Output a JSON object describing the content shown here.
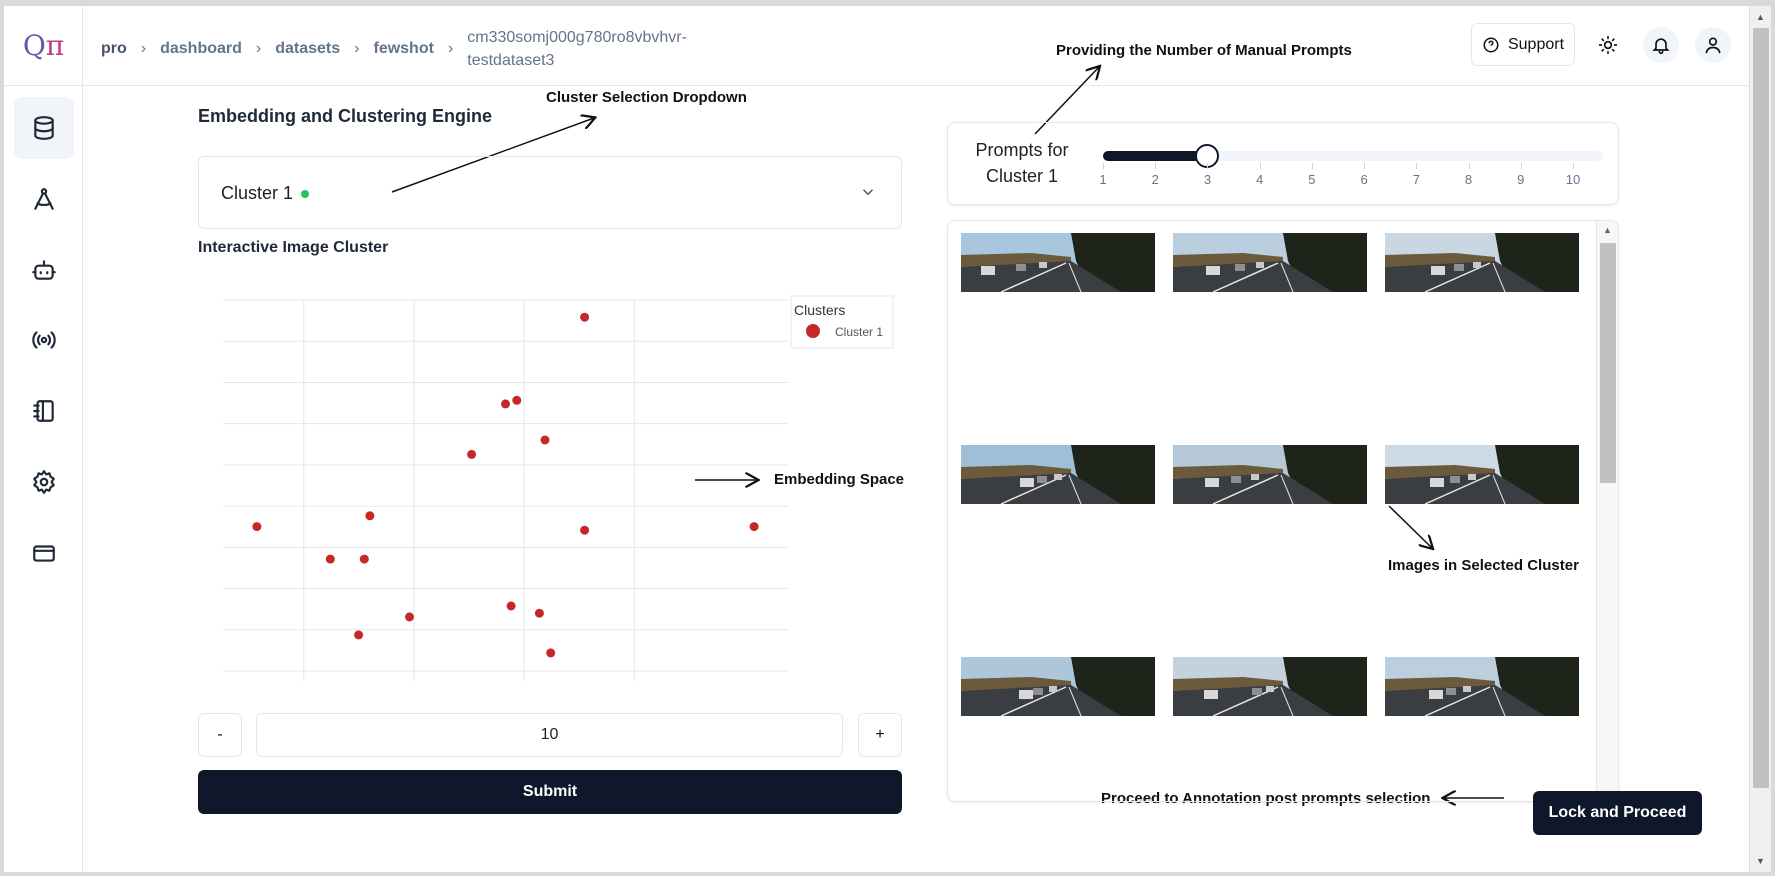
{
  "breadcrumb": [
    "pro",
    "dashboard",
    "datasets",
    "fewshot"
  ],
  "breadcrumb_last": "cm330somj000g780ro8vbvhvr-testdataset3",
  "header": {
    "support_label": "Support"
  },
  "main": {
    "title": "Embedding and Clustering Engine",
    "dropdown_value": "Cluster 1",
    "subtitle": "Interactive Image Cluster",
    "stepper": {
      "minus": "-",
      "plus": "+",
      "value": "10"
    },
    "submit_label": "Submit"
  },
  "prompts": {
    "label": "Prompts for Cluster 1",
    "slider_value": 3,
    "slider_min": 1,
    "slider_max": 10,
    "ticks": [
      "1",
      "2",
      "3",
      "4",
      "5",
      "6",
      "7",
      "8",
      "9",
      "10"
    ]
  },
  "annotations": {
    "cluster_dropdown": "Cluster Selection Dropdown",
    "manual_prompts": "Providing the Number of Manual Prompts",
    "embedding_space": "Embedding Space",
    "images_in_cluster": "Images in Selected Cluster",
    "proceed": "Proceed to Annotation post prompts selection"
  },
  "lock_label": "Lock and Proceed",
  "colors": {
    "point": "#c62828",
    "dark": "#0f172a",
    "status_green": "#22c55e"
  },
  "chart_data": {
    "type": "scatter",
    "legend_title": "Clusters",
    "legend_position": "top-right",
    "grid": true,
    "series": [
      {
        "name": "Cluster 1",
        "color": "#c62828",
        "points": [
          [
            0.06,
            0.4
          ],
          [
            0.19,
            0.31
          ],
          [
            0.24,
            0.1
          ],
          [
            0.25,
            0.31
          ],
          [
            0.26,
            0.43
          ],
          [
            0.33,
            0.15
          ],
          [
            0.44,
            0.6
          ],
          [
            0.5,
            0.74
          ],
          [
            0.51,
            0.18
          ],
          [
            0.52,
            0.75
          ],
          [
            0.56,
            0.16
          ],
          [
            0.57,
            0.64
          ],
          [
            0.58,
            0.05
          ],
          [
            0.64,
            0.98
          ],
          [
            0.64,
            0.39
          ],
          [
            0.94,
            0.4
          ]
        ]
      }
    ],
    "xlim": [
      0,
      1
    ],
    "ylim": [
      0,
      1
    ]
  },
  "gallery_images": [
    "road-scene",
    "road-scene",
    "road-scene",
    "road-scene",
    "road-scene",
    "road-scene",
    "road-scene",
    "road-scene",
    "road-scene"
  ]
}
